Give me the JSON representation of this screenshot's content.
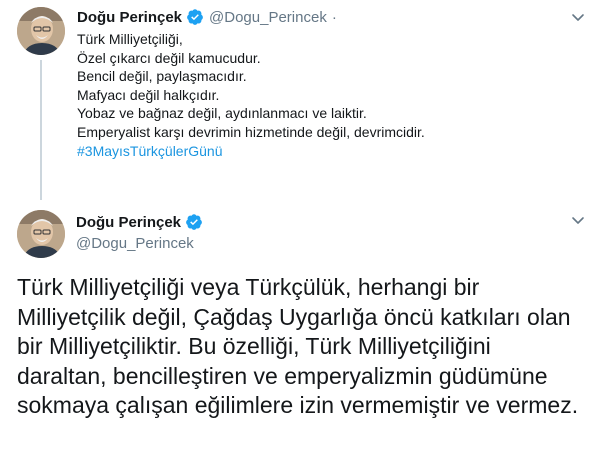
{
  "reply_tweet": {
    "name": "Doğu Perinçek",
    "handle": "@Dogu_Perincek",
    "separator": "·",
    "lines": [
      "Türk Milliyetçiliği,",
      "Özel çıkarcı değil kamucudur.",
      "Bencil değil, paylaşmacıdır.",
      "Mafyacı değil halkçıdır.",
      "Yobaz ve bağnaz değil, aydınlanmacı ve laiktir.",
      "Emperyalist karşı devrimin hizmetinde değil, devrimcidir."
    ],
    "hashtag": "#3MayısTürkçülerGünü"
  },
  "main_tweet": {
    "name": "Doğu Perinçek",
    "handle": "@Dogu_Perincek",
    "lines": [
      "Türk Milliyetçiliği veya Türkçülük, herhangi bir",
      "Milliyetçilik değil, Çağdaş Uygarlığa öncü katkıları olan",
      "bir Milliyetçiliktir. Bu özelliği, Türk Milliyetçiliğini",
      "daraltan, bencilleştiren ve emperyalizmin güdümüne",
      "sokmaya çalışan eğilimlere izin vermemiştir ve vermez."
    ]
  },
  "icons": {
    "verified": "verified-badge-icon",
    "menu": "chevron-down-icon"
  },
  "colors": {
    "verified": "#1da1f2",
    "link": "#1b95e0",
    "secondary_text": "#657786",
    "thread_line": "#ccd6dd"
  }
}
